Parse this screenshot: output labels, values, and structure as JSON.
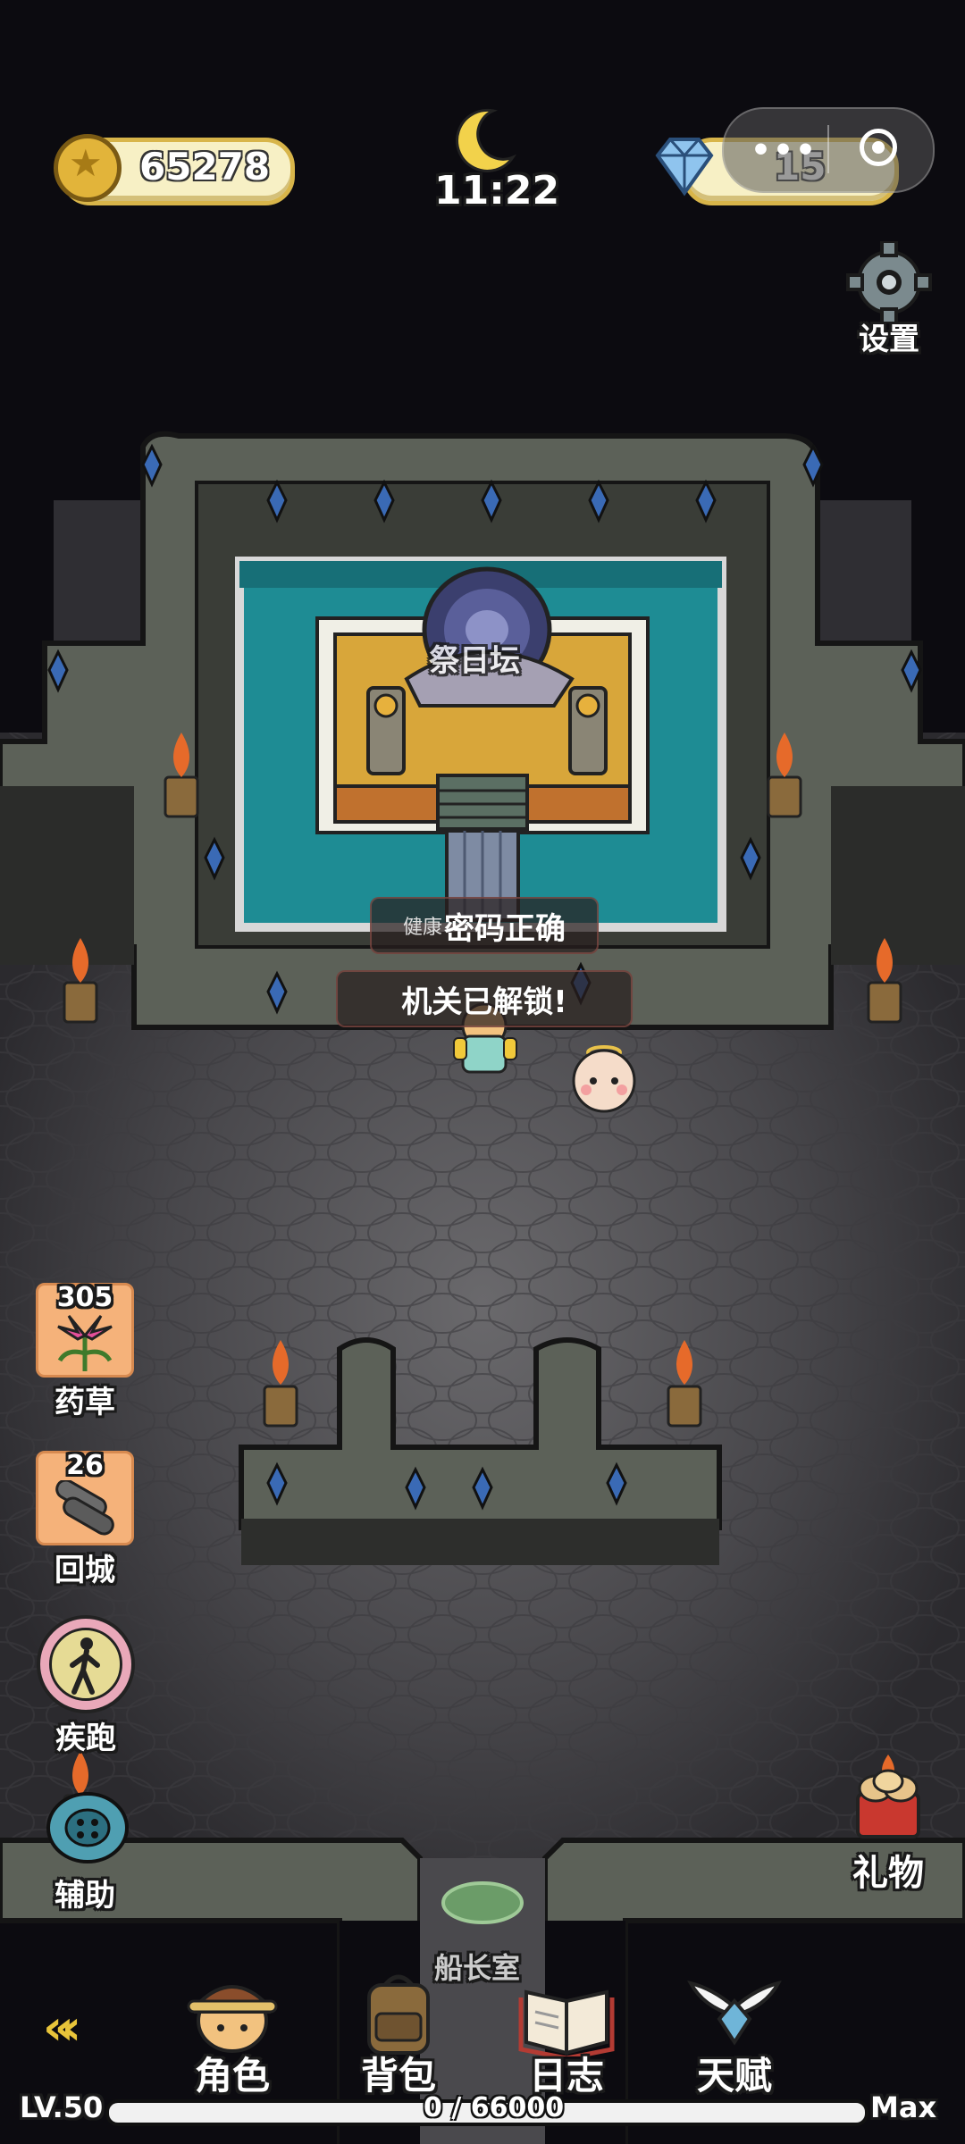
{
  "hud": {
    "coins": "65278",
    "time": "11:22",
    "gems": "15",
    "settings_label": "设置"
  },
  "map": {
    "altar_label": "祭日坛",
    "exit_label": "船长室"
  },
  "toasts": {
    "toast1_prefix": "健康",
    "toast1_text": "密码正确",
    "toast2_text": "机关已解锁!"
  },
  "side_left": {
    "herb_count": "305",
    "herb_label": "药草",
    "return_count": "26",
    "return_label": "回城",
    "sprint_label": "疾跑",
    "assist_label": "辅助"
  },
  "side_right": {
    "gift_label": "礼物"
  },
  "bottom": {
    "tabs": [
      "角色",
      "背包",
      "日志",
      "天赋"
    ],
    "level": "LV.50",
    "xp_text": "0 / 66000",
    "xp_progress": 0,
    "max_label": "Max"
  },
  "colors": {
    "water": "#1e8c94",
    "floor": "#4b4a4d",
    "rock": "#5b5f55",
    "altar_platform": "#d8a63a",
    "crystal": "#3a6ab5"
  }
}
